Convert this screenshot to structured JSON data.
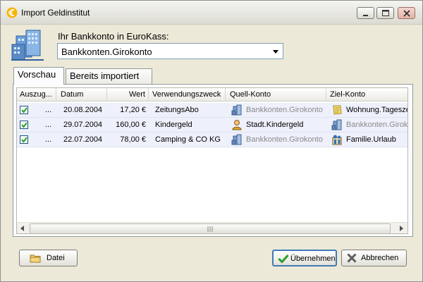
{
  "window": {
    "title": "Import Geldinstitut"
  },
  "konto": {
    "label": "Ihr Bankkonto in EuroKass:",
    "selected": "Bankkonten.Girokonto"
  },
  "tabs": [
    {
      "label": "Vorschau",
      "active": true
    },
    {
      "label": "Bereits importiert",
      "active": false
    }
  ],
  "table": {
    "columns": [
      "Auszug...",
      "Datum",
      "Wert",
      "Verwendungszweck",
      "Quell-Konto",
      "Ziel-Konto"
    ],
    "rows": [
      {
        "checked": true,
        "auszug": "...",
        "datum": "20.08.2004",
        "wert": "17,20 €",
        "zweck": "ZeitungsAbo",
        "quelle": "Bankkonten.Girokonto",
        "quelle_icon": "bank-account-icon",
        "ziel": "Wohnung.Tagesze",
        "ziel_icon": "notepad-icon"
      },
      {
        "checked": true,
        "auszug": "...",
        "datum": "29.07.2004",
        "wert": "160,00 €",
        "zweck": "Kindergeld",
        "quelle": "Stadt.Kindergeld",
        "quelle_icon": "person-icon",
        "ziel": "Bankkonten.Girokon",
        "ziel_icon": "bank-account-icon"
      },
      {
        "checked": true,
        "auszug": "...",
        "datum": "22.07.2004",
        "wert": "78,00 €",
        "zweck": "Camping & CO KG",
        "quelle": "Bankkonten.Girokonto",
        "quelle_icon": "bank-account-icon",
        "ziel": "Familie.Urlaub",
        "ziel_icon": "family-icon"
      }
    ]
  },
  "buttons": {
    "datei": "Datei",
    "uebernehmen": "Übernehmen",
    "abbrechen": "Abbrechen"
  },
  "colors": {
    "accent": "#3d7bb8",
    "row_bg": "#eef1fb",
    "inactive_text": "#8a8a8a"
  }
}
